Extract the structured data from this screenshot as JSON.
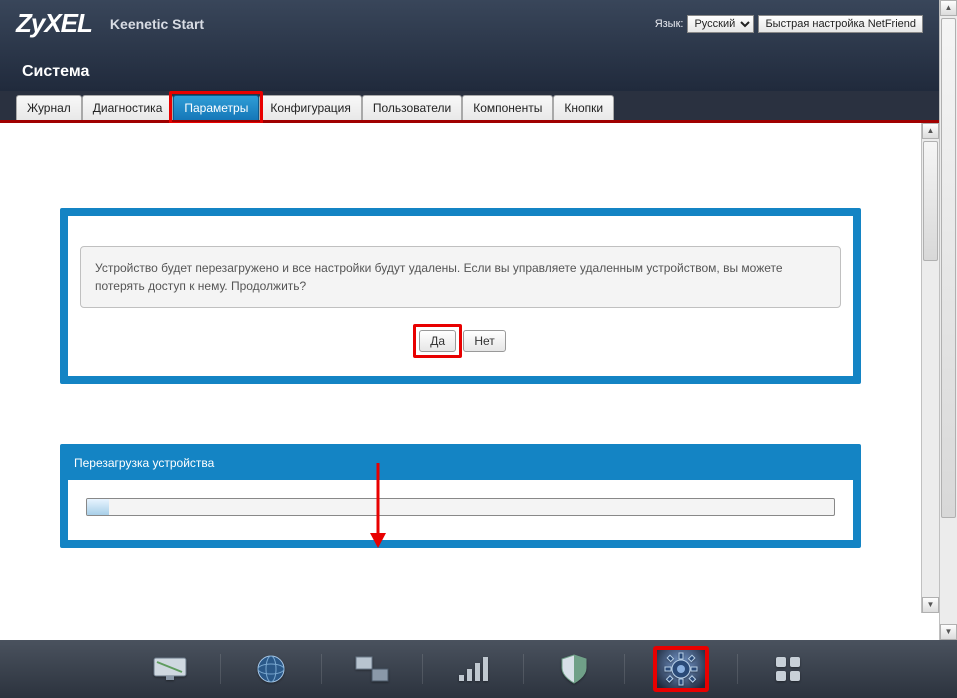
{
  "header": {
    "logo": "ZyXEL",
    "model": "Keenetic Start",
    "lang_label": "Язык:",
    "lang_value": "Русский",
    "netfriend": "Быстрая настройка NetFriend"
  },
  "page_title": "Система",
  "tabs": [
    {
      "label": "Журнал"
    },
    {
      "label": "Диагностика"
    },
    {
      "label": "Параметры"
    },
    {
      "label": "Конфигурация"
    },
    {
      "label": "Пользователи"
    },
    {
      "label": "Компоненты"
    },
    {
      "label": "Кнопки"
    }
  ],
  "dialog": {
    "text": "Устройство будет перезагружено и все настройки будут удалены. Если вы управляете удаленным устройством, вы можете потерять доступ к нему. Продолжить?",
    "yes": "Да",
    "no": "Нет"
  },
  "reboot_panel": {
    "title": "Перезагрузка устройства",
    "progress_percent": 3
  },
  "bottom_icons": [
    "monitor-icon",
    "globe-icon",
    "network-icon",
    "signal-icon",
    "shield-icon",
    "gear-icon",
    "apps-icon"
  ]
}
